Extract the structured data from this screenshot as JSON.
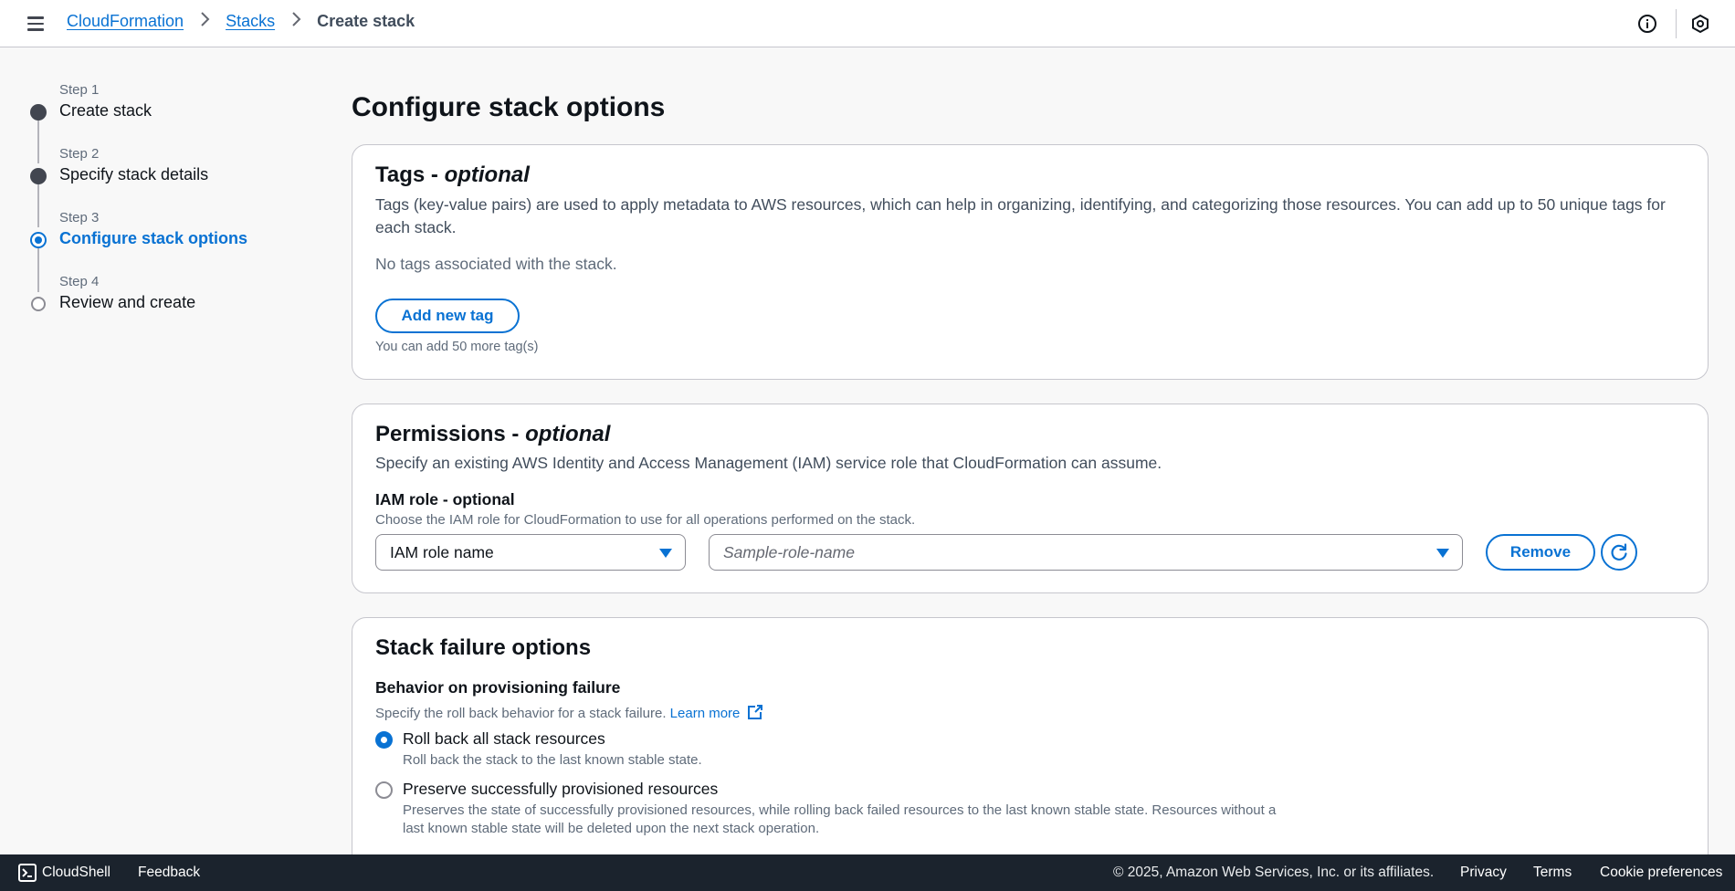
{
  "topbar": {
    "breadcrumb": [
      "CloudFormation",
      "Stacks",
      "Create stack"
    ],
    "icons": [
      "menu-icon",
      "info-icon",
      "settings-hexagon-icon"
    ]
  },
  "steps": [
    {
      "num": "Step 1",
      "label": "Create stack",
      "state": "done"
    },
    {
      "num": "Step 2",
      "label": "Specify stack details",
      "state": "done"
    },
    {
      "num": "Step 3",
      "label": "Configure stack options",
      "state": "active"
    },
    {
      "num": "Step 4",
      "label": "Review and create",
      "state": "todo"
    }
  ],
  "page_title": "Configure stack options",
  "tags": {
    "title": "Tags - ",
    "title_optional": "optional",
    "description": "Tags (key-value pairs) are used to apply metadata to AWS resources, which can help in organizing, identifying, and categorizing those resources. You can add up to 50 unique tags for each stack.",
    "empty_text": "No tags associated with the stack.",
    "add_button": "Add new tag",
    "hint": "You can add 50 more tag(s)"
  },
  "permissions": {
    "title": "Permissions - ",
    "title_optional": "optional",
    "description": "Specify an existing AWS Identity and Access Management (IAM) service role that CloudFormation can assume.",
    "iam_label": "IAM role - optional",
    "iam_desc": "Choose the IAM role for CloudFormation to use for all operations performed on the stack.",
    "type_select_value": "IAM role name",
    "role_select_placeholder": "Sample-role-name",
    "remove_button": "Remove"
  },
  "failure": {
    "title": "Stack failure options",
    "behavior_label": "Behavior on provisioning failure",
    "behavior_desc": "Specify the roll back behavior for a stack failure.",
    "learn_more": "Learn more",
    "options": [
      {
        "label": "Roll back all stack resources",
        "desc": "Roll back the stack to the last known stable state.",
        "checked": true
      },
      {
        "label": "Preserve successfully provisioned resources",
        "desc": "Preserves the state of successfully provisioned resources, while rolling back failed resources to the last known stable state. Resources without a last known stable state will be deleted upon the next stack operation.",
        "checked": false
      }
    ]
  },
  "footer": {
    "cloudshell": "CloudShell",
    "feedback": "Feedback",
    "copyright": "© 2025, Amazon Web Services, Inc. or its affiliates.",
    "privacy": "Privacy",
    "terms": "Terms",
    "cookie": "Cookie preferences"
  },
  "colors": {
    "accent": "#0972d3",
    "footer_bg": "#1b232d",
    "page_bg": "#f8f8f8"
  }
}
